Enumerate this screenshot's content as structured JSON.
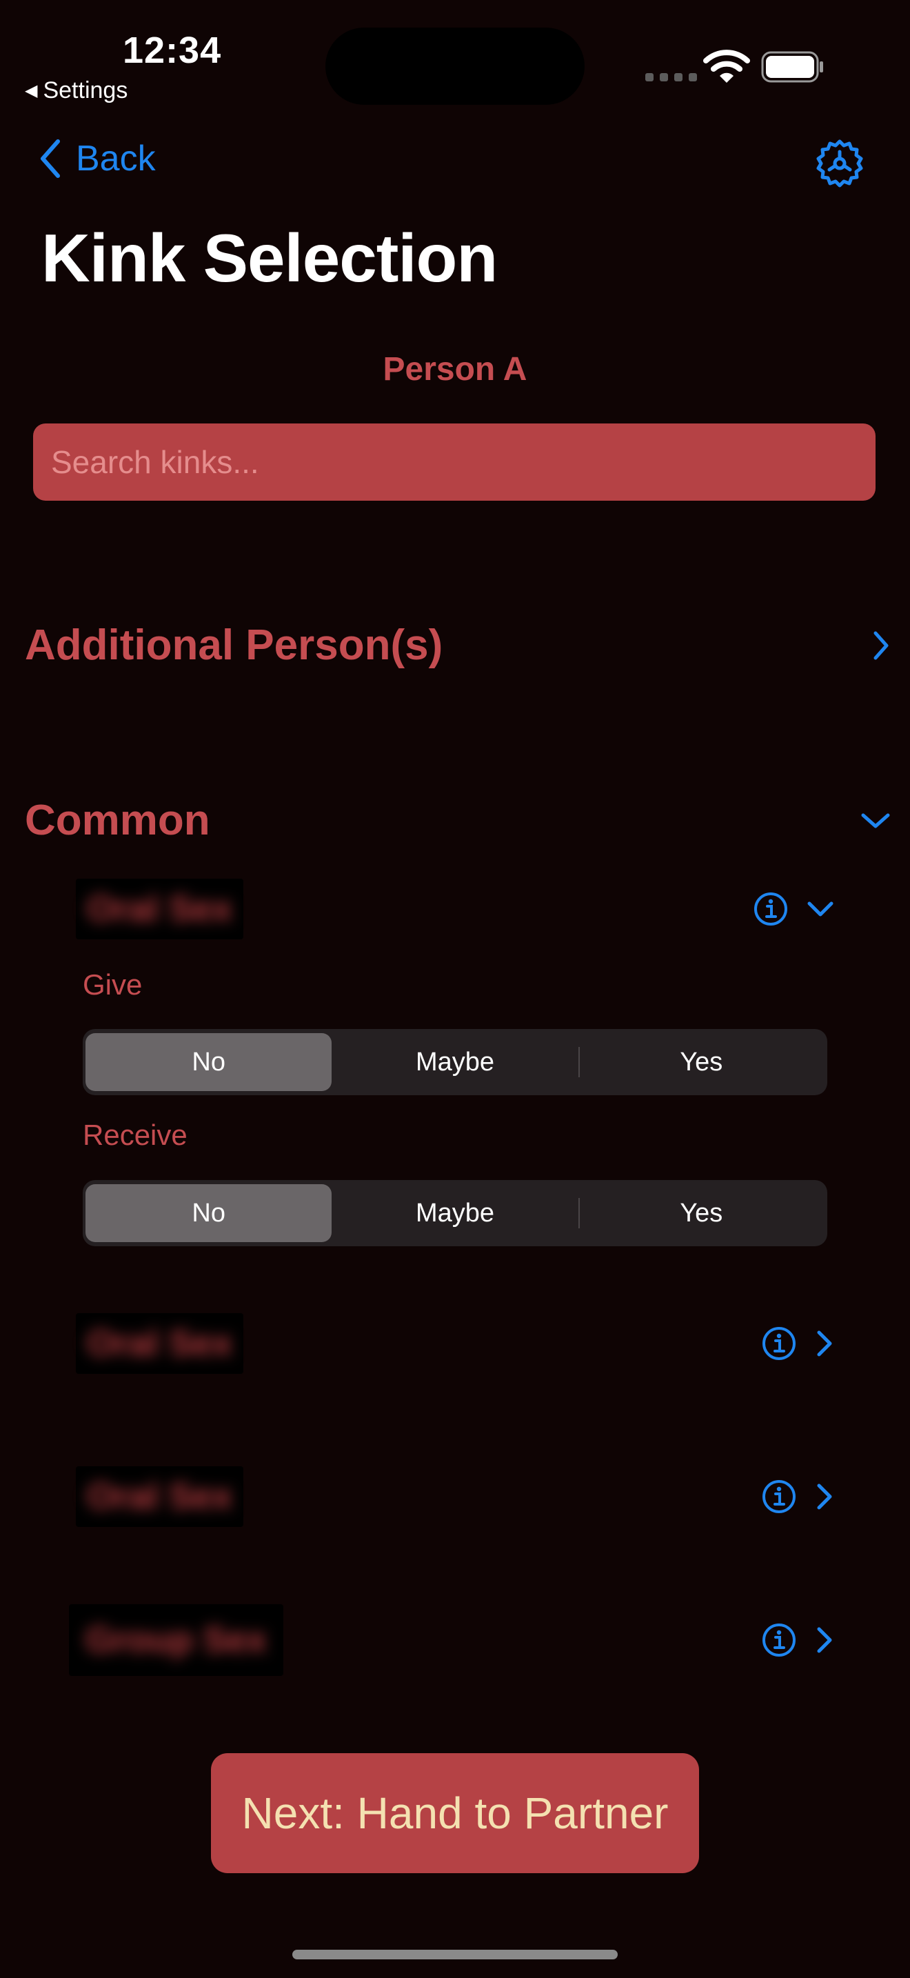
{
  "status_bar": {
    "time": "12:34",
    "back_app": "Settings"
  },
  "nav": {
    "back_label": "Back",
    "title": "Kink Selection"
  },
  "person_label": "Person A",
  "search": {
    "placeholder": "Search kinks...",
    "value": ""
  },
  "sections": {
    "additional": {
      "title": "Additional Person(s)",
      "expanded": false
    },
    "common": {
      "title": "Common",
      "expanded": true
    }
  },
  "kinks": [
    {
      "label": "Oral Sex",
      "expanded": true
    },
    {
      "label": "Oral Sex",
      "expanded": false
    },
    {
      "label": "Oral Sex",
      "expanded": false
    },
    {
      "label": "Group Sex",
      "expanded": false
    }
  ],
  "preferences": {
    "give_label": "Give",
    "receive_label": "Receive",
    "options": [
      "No",
      "Maybe",
      "Yes"
    ],
    "give_selected": "No",
    "receive_selected": "No"
  },
  "next_button": "Next: Hand to Partner",
  "colors": {
    "background": "#0f0404",
    "accent_red": "#c54d51",
    "button_red": "#b54245",
    "link_blue": "#1f86f0",
    "button_text": "#f4e1b1"
  },
  "icons": {
    "back": "chevron-left-icon",
    "settings": "gear-icon",
    "info": "info-circle-icon",
    "expand": "chevron-down-icon",
    "collapse": "chevron-right-icon"
  }
}
